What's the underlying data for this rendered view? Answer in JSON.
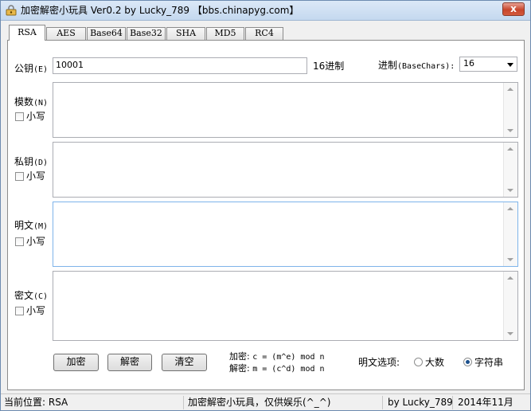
{
  "window": {
    "title": "加密解密小玩具 Ver0.2 by Lucky_789  【bbs.chinapyg.com】",
    "close_glyph": "x"
  },
  "tabs": [
    {
      "label": "RSA",
      "active": true
    },
    {
      "label": "AES"
    },
    {
      "label": "Base64"
    },
    {
      "label": "Base32"
    },
    {
      "label": "SHA"
    },
    {
      "label": "MD5"
    },
    {
      "label": "RC4"
    }
  ],
  "rsa": {
    "public_key": {
      "label": "公钥",
      "hotkey": "(E)",
      "value": "10001",
      "hex_suffix": "16进制"
    },
    "base": {
      "label": "进制",
      "hotkey": "(BaseChars):",
      "selected": "16"
    },
    "modulus": {
      "label": "模数",
      "hotkey": "(N)",
      "lowercase_label": "小写"
    },
    "private_key": {
      "label": "私钥",
      "hotkey": "(D)",
      "lowercase_label": "小写"
    },
    "plaintext": {
      "label": "明文",
      "hotkey": "(M)",
      "lowercase_label": "小写"
    },
    "ciphertext": {
      "label": "密文",
      "hotkey": "(C)",
      "lowercase_label": "小写"
    },
    "buttons": {
      "encrypt": "加密",
      "decrypt": "解密",
      "clear": "清空"
    },
    "formula": {
      "encrypt_prefix": "加密:",
      "encrypt_expr": "c = (m^e) mod n",
      "decrypt_prefix": "解密:",
      "decrypt_expr": "m = (c^d) mod n"
    },
    "plaintext_options": {
      "label": "明文选项:",
      "options": [
        "大数",
        "字符串"
      ],
      "selected": "字符串"
    }
  },
  "status": {
    "location": "当前位置: RSA",
    "message": "加密解密小玩具，仅供娱乐(^_^)",
    "author": "by Lucky_789",
    "date": "2014年11月"
  }
}
